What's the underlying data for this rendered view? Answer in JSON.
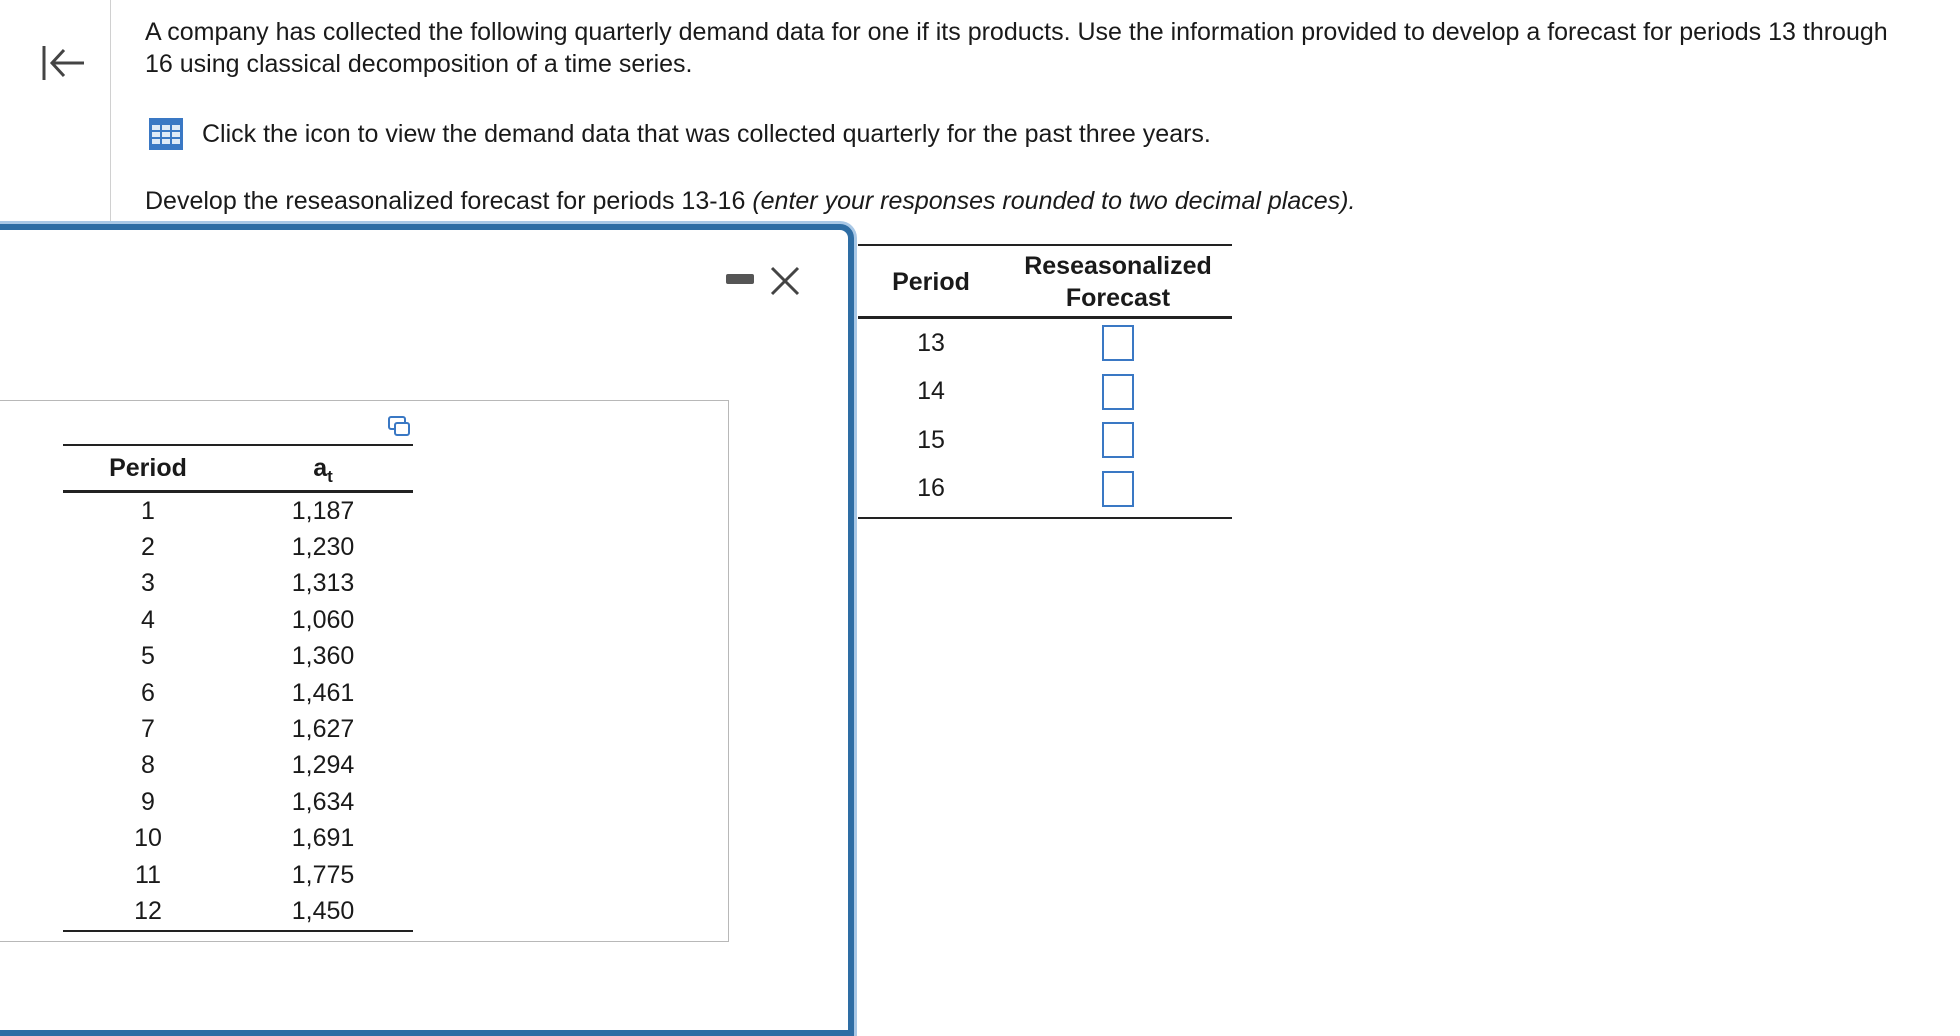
{
  "question": {
    "text": "A company has collected the following quarterly demand data for one if its products. Use the information provided to develop a forecast for periods 13 through 16 using classical decomposition of a time series.",
    "data_link_text": "Click the icon to view the demand data that was collected quarterly for the past three years.",
    "instruction_text": "Develop the reseasonalized forecast for periods 13-16",
    "instruction_italic": "(enter your responses rounded to two decimal places)."
  },
  "popup": {
    "table": {
      "headers": {
        "period": "Period",
        "demand": "a",
        "demand_sub": "t"
      },
      "rows": [
        {
          "period": "1",
          "value": "1,187"
        },
        {
          "period": "2",
          "value": "1,230"
        },
        {
          "period": "3",
          "value": "1,313"
        },
        {
          "period": "4",
          "value": "1,060"
        },
        {
          "period": "5",
          "value": "1,360"
        },
        {
          "period": "6",
          "value": "1,461"
        },
        {
          "period": "7",
          "value": "1,627"
        },
        {
          "period": "8",
          "value": "1,294"
        },
        {
          "period": "9",
          "value": "1,634"
        },
        {
          "period": "10",
          "value": "1,691"
        },
        {
          "period": "11",
          "value": "1,775"
        },
        {
          "period": "12",
          "value": "1,450"
        }
      ]
    }
  },
  "answer_table": {
    "headers": {
      "period": "Period",
      "forecast_line1": "Reseasonalized",
      "forecast_line2": "Forecast"
    },
    "rows": [
      {
        "period": "13",
        "value": ""
      },
      {
        "period": "14",
        "value": ""
      },
      {
        "period": "15",
        "value": ""
      },
      {
        "period": "16",
        "value": ""
      }
    ]
  },
  "colors": {
    "accent": "#2e6da4",
    "input_border": "#3a78c4",
    "icon_blue": "#3a78c4"
  }
}
